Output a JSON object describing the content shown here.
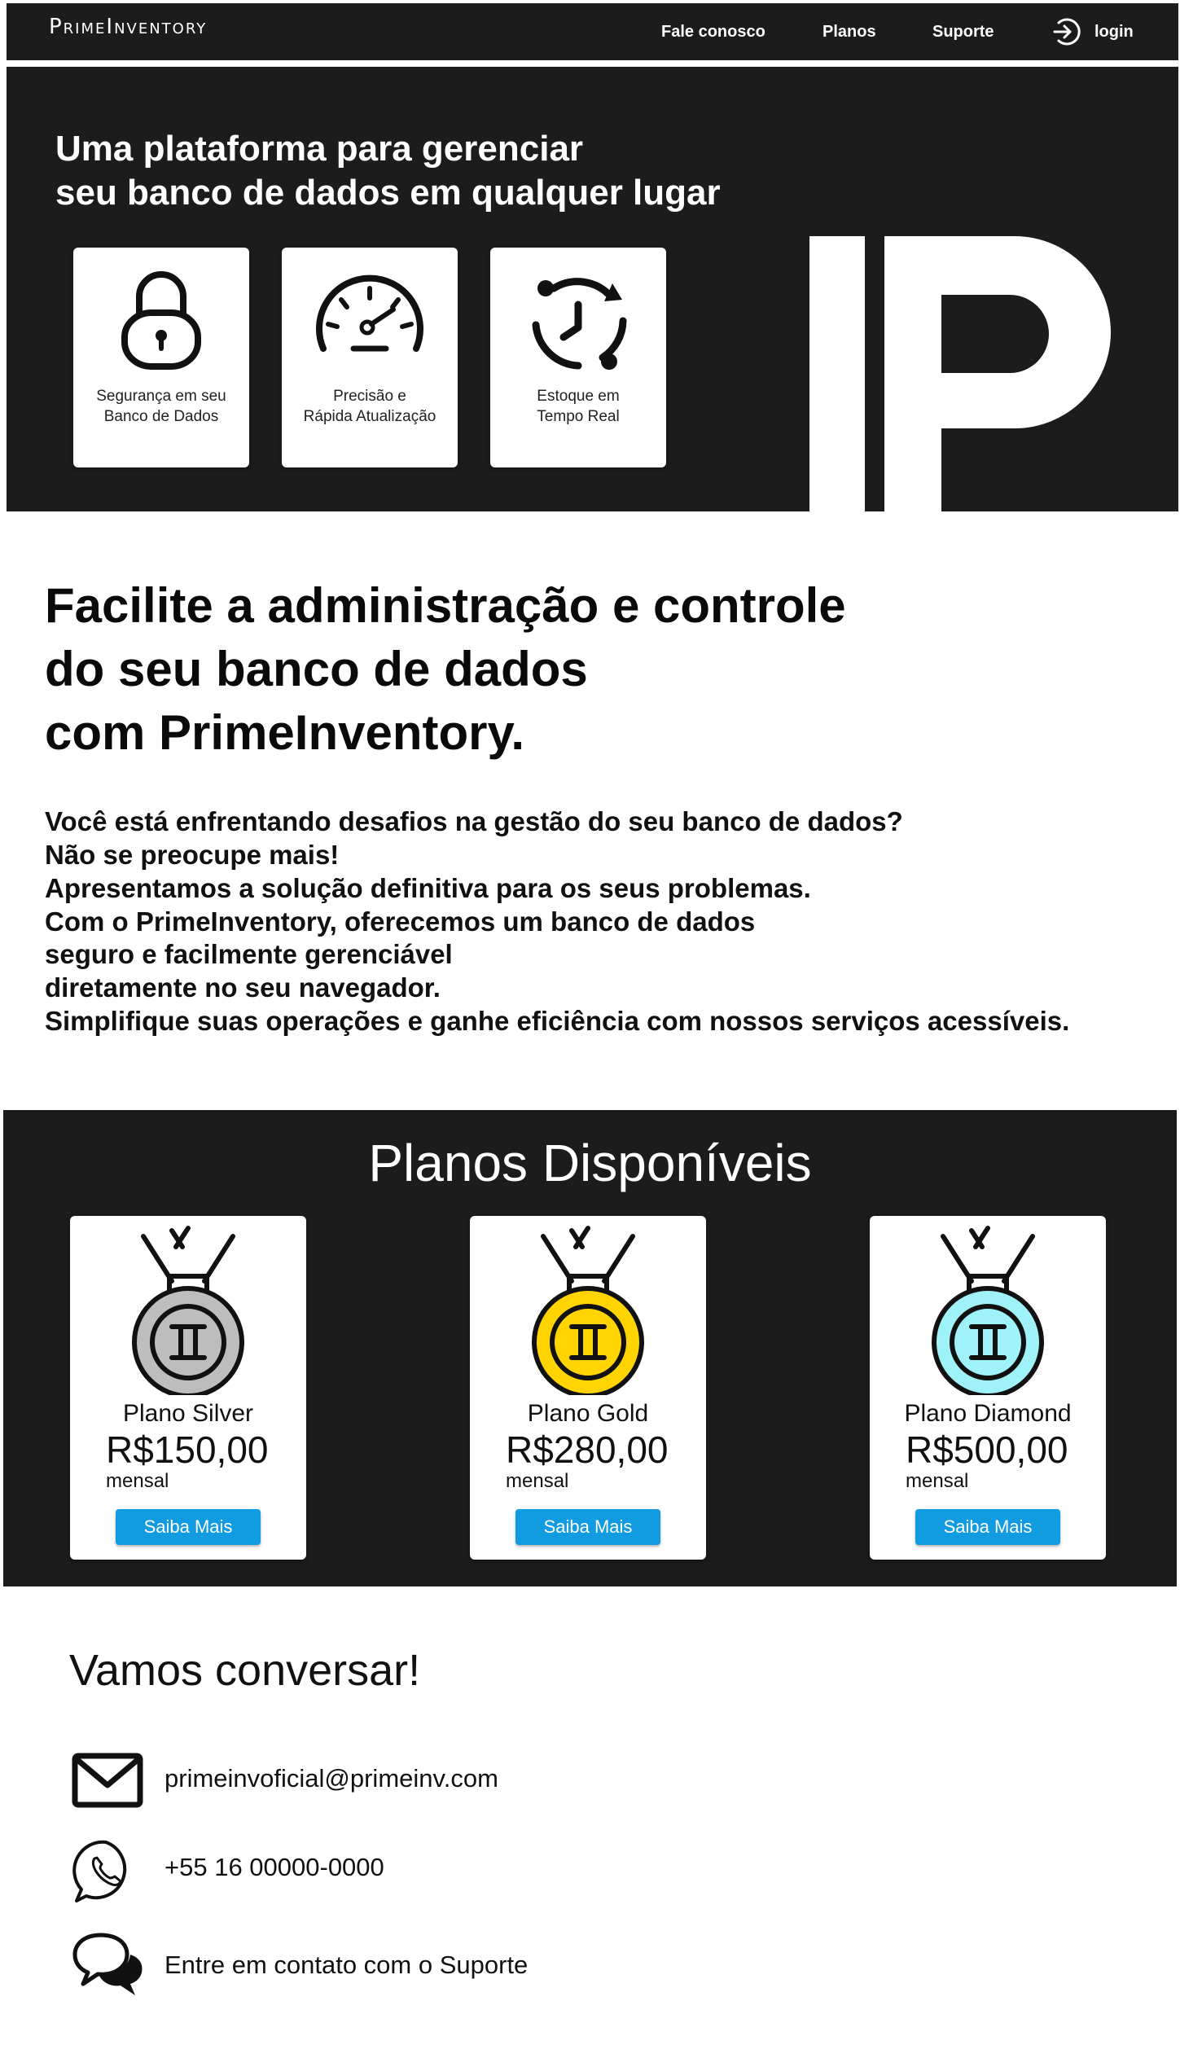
{
  "navbar": {
    "logo": "PrimeInventory",
    "links": [
      "Fale conosco",
      "Planos",
      "Suporte"
    ],
    "login_label": "login",
    "login_icon": "login-icon"
  },
  "hero": {
    "title_line1": "Uma plataforma para gerenciar",
    "title_line2": "seu banco de dados em qualquer lugar",
    "features": [
      {
        "icon": "padlock-icon",
        "line1": "Segurança em seu",
        "line2": "Banco de Dados"
      },
      {
        "icon": "speedometer-icon",
        "line1": "Precisão e",
        "line2": "Rápida Atualização"
      },
      {
        "icon": "clock-refresh-icon",
        "line1": "Estoque em",
        "line2": "Tempo Real"
      }
    ],
    "brand_mark": "P"
  },
  "intro": {
    "headline": [
      "Facilite a administração e controle",
      "do seu banco de dados",
      "com PrimeInventory."
    ],
    "paragraph": [
      "Você está enfrentando desafios na gestão do seu banco de dados?",
      "Não se preocupe mais!",
      "Apresentamos a solução definitiva para os seus problemas.",
      "Com o PrimeInventory, oferecemos um banco de dados",
      "seguro e facilmente gerenciável",
      "diretamente no seu navegador.",
      "Simplifique suas operações e ganhe eficiência com nossos serviços acessíveis."
    ]
  },
  "plans": {
    "title": "Planos Disponíveis",
    "items": [
      {
        "name": "Plano Silver",
        "price": "R$150,00",
        "period": "mensal",
        "button": "Saiba Mais",
        "medal_color": "#bdbdbd"
      },
      {
        "name": "Plano Gold",
        "price": "R$280,00",
        "period": "mensal",
        "button": "Saiba Mais",
        "medal_color": "#ffd400"
      },
      {
        "name": "Plano Diamond",
        "price": "R$500,00",
        "period": "mensal",
        "button": "Saiba Mais",
        "medal_color": "#9ef2f8"
      }
    ]
  },
  "contact": {
    "title": "Vamos conversar!",
    "items": [
      {
        "icon": "envelope-icon",
        "text": "primeinvoficial@primeinv.com"
      },
      {
        "icon": "whatsapp-icon",
        "text": "+55 16 00000-0000"
      },
      {
        "icon": "chat-bubbles-icon",
        "text": "Entre em contato com o Suporte"
      }
    ]
  },
  "colors": {
    "dark": "#1c1c1c",
    "accent": "#119be0"
  }
}
